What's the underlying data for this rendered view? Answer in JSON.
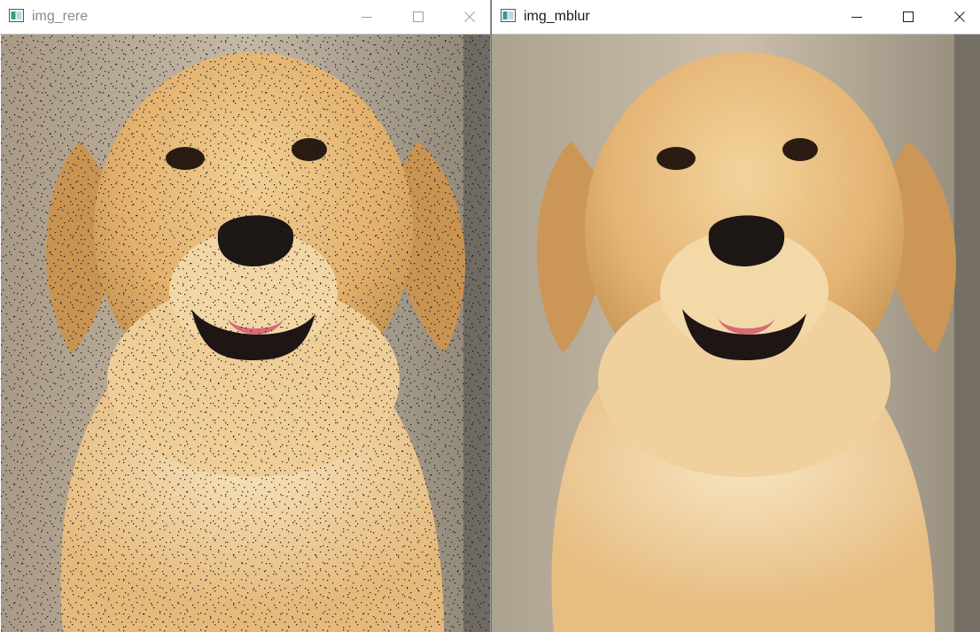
{
  "windows": [
    {
      "title": "img_rere",
      "active": false,
      "image": "golden-retriever-salt-noise",
      "controls": [
        "minimize-icon",
        "maximize-icon",
        "close-icon"
      ]
    },
    {
      "title": "img_mblur",
      "active": true,
      "image": "golden-retriever-median-blurred",
      "controls": [
        "minimize-icon",
        "maximize-icon",
        "close-icon"
      ]
    }
  ],
  "colors": {
    "inactive_title": "#8a8a8a",
    "active_title": "#1a1a1a",
    "fur": "#e3b576",
    "background": "#b8aa98"
  }
}
